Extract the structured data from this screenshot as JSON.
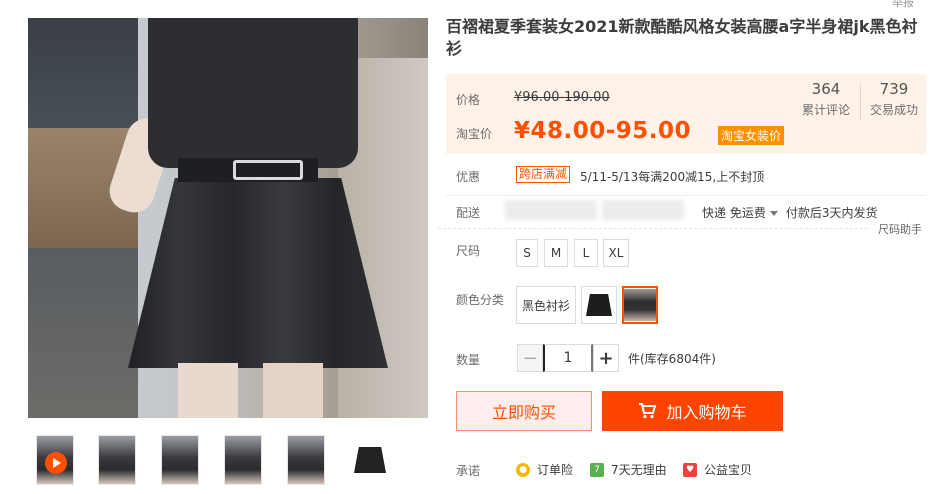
{
  "report_text": "举报",
  "product": {
    "title": "百褶裙夏季套装女2021新款酷酷风格女装高腰a字半身裙jk黑色衬衫"
  },
  "price": {
    "label": "价格",
    "original": "¥96.00-190.00",
    "promo_label": "淘宝价",
    "current": "¥48.00-95.00",
    "tag": "淘宝女装价"
  },
  "stats": [
    {
      "value": "364",
      "label": "累计评论"
    },
    {
      "value": "739",
      "label": "交易成功"
    }
  ],
  "promo": {
    "label": "优惠",
    "tag": "跨店满减",
    "text": "5/11-5/13每满200减15,上不封顶"
  },
  "delivery": {
    "label": "配送",
    "shipping": "快递 免运费",
    "ship_time": "付款后3天内发货"
  },
  "size_help": "尺码助手",
  "size": {
    "label": "尺码",
    "options": [
      "S",
      "M",
      "L",
      "XL"
    ]
  },
  "color": {
    "label": "颜色分类",
    "options": [
      {
        "label": "黑色衬衫",
        "type": "text"
      },
      {
        "label": "",
        "type": "skirt-image"
      },
      {
        "label": "",
        "type": "photo-image",
        "selected": true
      }
    ]
  },
  "quantity": {
    "label": "数量",
    "minus": "−",
    "value": "1",
    "plus": "+",
    "stock": "件(库存6804件)"
  },
  "actions": {
    "buy_now": "立即购买",
    "add_to_cart": "加入购物车"
  },
  "promise": {
    "label": "承诺",
    "items": [
      {
        "text": "订单险",
        "icon": "order-insurance-icon",
        "color": "#f5b800"
      },
      {
        "text": "7天无理由",
        "icon": "seven-days-icon",
        "color": "#5ab04f"
      },
      {
        "text": "公益宝贝",
        "icon": "charity-icon",
        "color": "#e8463a"
      }
    ]
  },
  "colors": {
    "accent": "#ff5000",
    "cart_bg": "#ff4400",
    "price_bg": "#fff2e8"
  }
}
